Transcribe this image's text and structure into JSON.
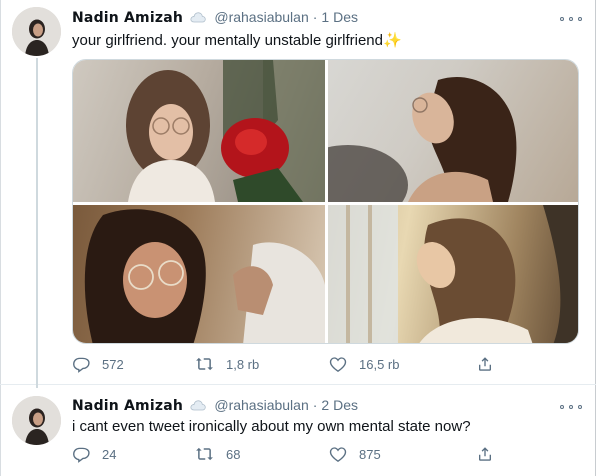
{
  "tweets": [
    {
      "author": {
        "name": "Nadin Amizah",
        "handle": "@rahasiabulan"
      },
      "separator": "·",
      "date": "1 Des",
      "text": "your girlfriend. your mentally unstable girlfriend",
      "emoji": "✨",
      "media_count": 4,
      "stats": {
        "replies": "572",
        "retweets": "1,8 rb",
        "likes": "16,5 rb"
      }
    },
    {
      "author": {
        "name": "Nadin Amizah",
        "handle": "@rahasiabulan"
      },
      "separator": "·",
      "date": "2 Des",
      "text": "i cant even tweet ironically about my own mental state now?",
      "stats": {
        "replies": "24",
        "retweets": "68",
        "likes": "875"
      }
    }
  ],
  "colors": {
    "text": "#0f1419",
    "secondary": "#5b7083",
    "border": "#e6ecf0"
  },
  "icons": [
    "cloud-badge-icon",
    "more-icon",
    "reply-icon",
    "retweet-icon",
    "like-icon",
    "share-icon"
  ]
}
